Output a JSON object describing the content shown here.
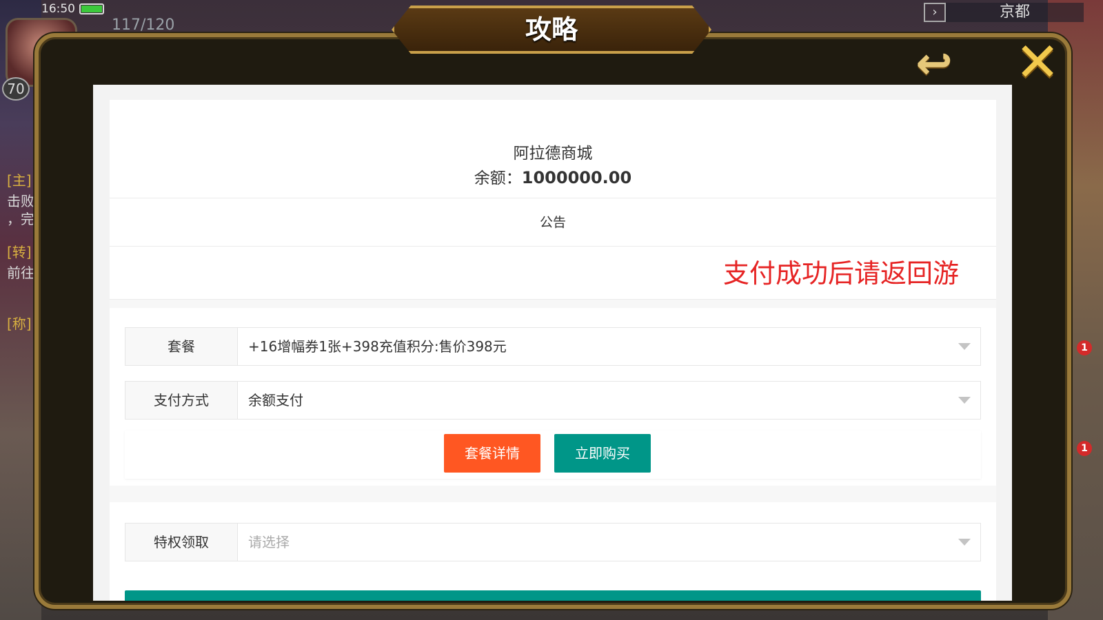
{
  "status": {
    "time": "16:50",
    "energy": "117/120",
    "level": "70",
    "location": "京都"
  },
  "side_labels": [
    "[主]",
    "击败",
    "，完",
    "[转]",
    "前往",
    "[称]"
  ],
  "badges": [
    "1",
    "1"
  ],
  "dialog": {
    "title": "攻略",
    "back_icon": "back-arrow-icon",
    "close_icon": "close-x-icon"
  },
  "shop": {
    "name": "阿拉德商城",
    "balance_label": "余额：",
    "balance_value": "1000000.00",
    "notice_title": "公告",
    "notice_marquee": "支付成功后请返回游"
  },
  "form": {
    "package_label": "套餐",
    "package_value": "+16增幅券1张+398充值积分:售价398元",
    "payment_label": "支付方式",
    "payment_value": "余额支付",
    "privilege_label": "特权领取",
    "privilege_placeholder": "请选择"
  },
  "buttons": {
    "details_label": "套餐详情",
    "buy_label": "立即购买"
  },
  "colors": {
    "accent_orange": "#ff5722",
    "accent_teal": "#009688",
    "notice_red": "#e62424",
    "frame_gold": "#c9a04a"
  }
}
